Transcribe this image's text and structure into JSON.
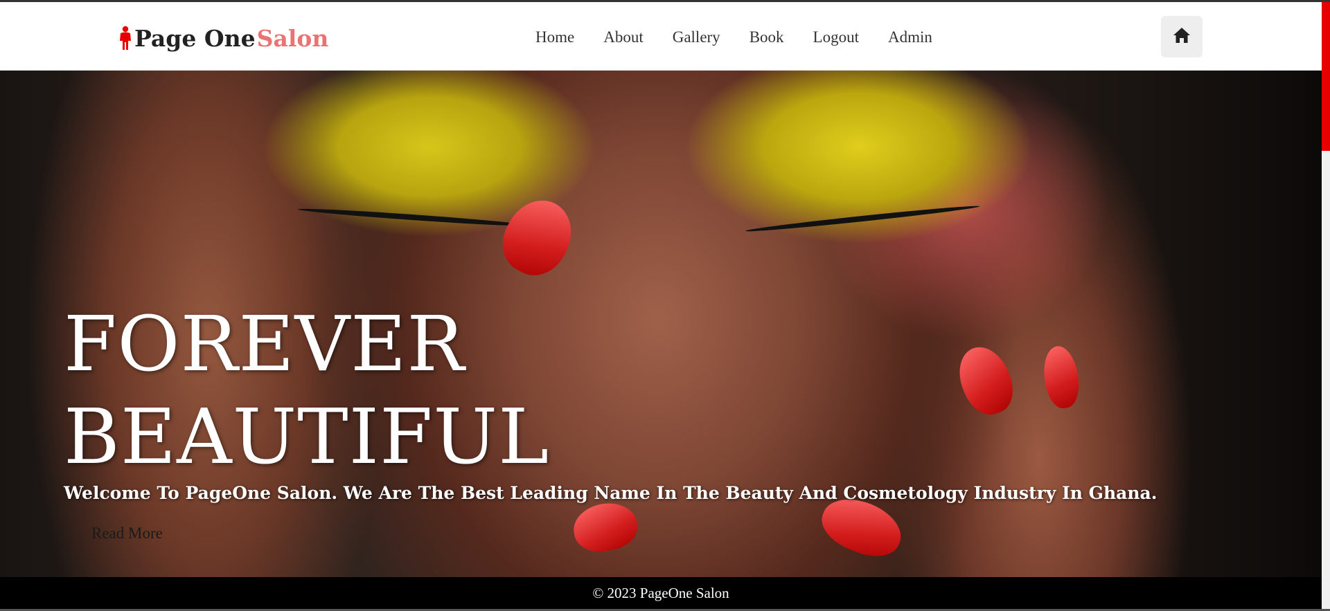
{
  "brand": {
    "name_part1": "Page One",
    "name_part2": "Salon",
    "icon": "person-icon",
    "accent_color": "#ec7373",
    "icon_color": "#e60000"
  },
  "nav": {
    "links": [
      "Home",
      "About",
      "Gallery",
      "Book",
      "Logout",
      "Admin"
    ],
    "home_button_icon": "home-icon"
  },
  "hero": {
    "title_line1": "FOREVER",
    "title_line2": "BEAUTIFUL",
    "subtitle": "Welcome To PageOne Salon. We Are The Best Leading Name In The Beauty And Cosmetology Industry In Ghana.",
    "read_more": "Read More"
  },
  "footer": {
    "text": "© 2023 PageOne Salon"
  },
  "colors": {
    "scrollbar_thumb": "#e60000",
    "footer_bg": "#000000"
  }
}
